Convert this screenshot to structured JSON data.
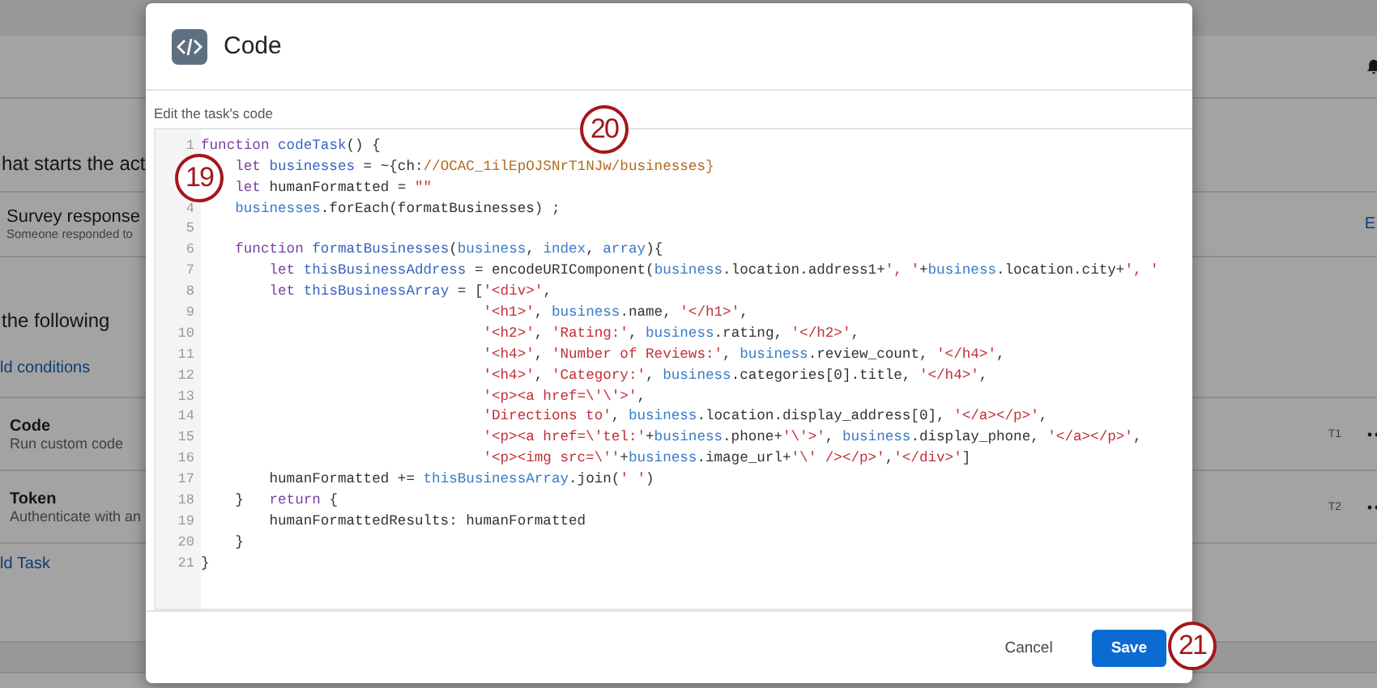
{
  "background": {
    "trigger_heading": "hat starts the act",
    "trigger": {
      "title": "Survey response",
      "subtitle": "Someone responded to",
      "action": "E"
    },
    "conditions_heading": "the following",
    "add_conditions": "ld conditions",
    "tasks": [
      {
        "title": "Code",
        "subtitle": "Run custom code",
        "tag": "T1"
      },
      {
        "title": "Token",
        "subtitle": "Authenticate with an",
        "tag": "T2"
      }
    ],
    "add_task": "ld Task"
  },
  "dialog": {
    "title": "Code",
    "editor_label": "Edit the task's code",
    "code_lines": [
      {
        "number": "1",
        "tokens": [
          {
            "kind": "keyword",
            "text": "function "
          },
          {
            "kind": "name",
            "text": "codeTask"
          },
          {
            "kind": "plain",
            "text": "() {"
          }
        ]
      },
      {
        "tokens": [
          {
            "kind": "keyword",
            "text": "    let "
          },
          {
            "kind": "name",
            "text": "businesses"
          },
          {
            "kind": "plain",
            "text": " = ~{ch:"
          },
          {
            "kind": "path",
            "text": "//OCAC_1ilEpOJSNrT1NJw/businesses}"
          }
        ]
      },
      {
        "tokens": [
          {
            "kind": "keyword",
            "text": "    let"
          },
          {
            "kind": "plain",
            "text": " humanFormatted = "
          },
          {
            "kind": "string",
            "text": "\"\""
          }
        ]
      },
      {
        "number": "4",
        "tokens": [
          {
            "kind": "variable",
            "text": "    businesses"
          },
          {
            "kind": "plain",
            "text": ".forEach(formatBusinesses) ;"
          }
        ]
      },
      {
        "number": "5"
      },
      {
        "number": "6",
        "tokens": [
          {
            "kind": "keyword",
            "text": "    function "
          },
          {
            "kind": "name",
            "text": "formatBusinesses"
          },
          {
            "kind": "plain",
            "text": "("
          },
          {
            "kind": "variable",
            "text": "business"
          },
          {
            "kind": "plain",
            "text": ", "
          },
          {
            "kind": "variable",
            "text": "index"
          },
          {
            "kind": "plain",
            "text": ", "
          },
          {
            "kind": "variable",
            "text": "array"
          },
          {
            "kind": "plain",
            "text": "){"
          }
        ]
      },
      {
        "number": "7",
        "tokens": [
          {
            "kind": "keyword",
            "text": "        let "
          },
          {
            "kind": "name",
            "text": "thisBusinessAddress"
          },
          {
            "kind": "plain",
            "text": " = encodeURIComponent("
          },
          {
            "kind": "variable",
            "text": "business"
          },
          {
            "kind": "plain",
            "text": ".location.address1+"
          },
          {
            "kind": "string",
            "text": "', '"
          },
          {
            "kind": "plain",
            "text": "+"
          },
          {
            "kind": "variable",
            "text": "business"
          },
          {
            "kind": "plain",
            "text": ".location.city+"
          },
          {
            "kind": "string",
            "text": "', '"
          }
        ]
      },
      {
        "number": "8",
        "tokens": [
          {
            "kind": "keyword",
            "text": "        let "
          },
          {
            "kind": "name",
            "text": "thisBusinessArray"
          },
          {
            "kind": "plain",
            "text": " = ["
          },
          {
            "kind": "string",
            "text": "'<div>'"
          },
          {
            "kind": "plain",
            "text": ","
          }
        ]
      },
      {
        "number": "9",
        "tokens": [
          {
            "kind": "string",
            "text": "                                 '<h1>'"
          },
          {
            "kind": "plain",
            "text": ", "
          },
          {
            "kind": "variable",
            "text": "business"
          },
          {
            "kind": "plain",
            "text": ".name, "
          },
          {
            "kind": "string",
            "text": "'</h1>'"
          },
          {
            "kind": "plain",
            "text": ","
          }
        ]
      },
      {
        "number": "10",
        "tokens": [
          {
            "kind": "string",
            "text": "                                 '<h2>'"
          },
          {
            "kind": "plain",
            "text": ", "
          },
          {
            "kind": "string",
            "text": "'Rating:'"
          },
          {
            "kind": "plain",
            "text": ", "
          },
          {
            "kind": "variable",
            "text": "business"
          },
          {
            "kind": "plain",
            "text": ".rating, "
          },
          {
            "kind": "string",
            "text": "'</h2>'"
          },
          {
            "kind": "plain",
            "text": ","
          }
        ]
      },
      {
        "number": "11",
        "tokens": [
          {
            "kind": "string",
            "text": "                                 '<h4>'"
          },
          {
            "kind": "plain",
            "text": ", "
          },
          {
            "kind": "string",
            "text": "'Number of Reviews:'"
          },
          {
            "kind": "plain",
            "text": ", "
          },
          {
            "kind": "variable",
            "text": "business"
          },
          {
            "kind": "plain",
            "text": ".review_count, "
          },
          {
            "kind": "string",
            "text": "'</h4>'"
          },
          {
            "kind": "plain",
            "text": ","
          }
        ]
      },
      {
        "number": "12",
        "tokens": [
          {
            "kind": "string",
            "text": "                                 '<h4>'"
          },
          {
            "kind": "plain",
            "text": ", "
          },
          {
            "kind": "string",
            "text": "'Category:'"
          },
          {
            "kind": "plain",
            "text": ", "
          },
          {
            "kind": "variable",
            "text": "business"
          },
          {
            "kind": "plain",
            "text": ".categories[0].title, "
          },
          {
            "kind": "string",
            "text": "'</h4>'"
          },
          {
            "kind": "plain",
            "text": ","
          }
        ]
      },
      {
        "number": "13",
        "tokens": [
          {
            "kind": "string",
            "text": "                                 '<p><a href=\\'\\'>'"
          },
          {
            "kind": "plain",
            "text": ","
          }
        ]
      },
      {
        "number": "14",
        "tokens": [
          {
            "kind": "string",
            "text": "                                 'Directions to'"
          },
          {
            "kind": "plain",
            "text": ", "
          },
          {
            "kind": "variable",
            "text": "business"
          },
          {
            "kind": "plain",
            "text": ".location.display_address[0], "
          },
          {
            "kind": "string",
            "text": "'</a></p>'"
          },
          {
            "kind": "plain",
            "text": ","
          }
        ]
      },
      {
        "number": "15",
        "tokens": [
          {
            "kind": "string",
            "text": "                                 '<p><a href=\\'tel:'"
          },
          {
            "kind": "plain",
            "text": "+"
          },
          {
            "kind": "variable",
            "text": "business"
          },
          {
            "kind": "plain",
            "text": ".phone+"
          },
          {
            "kind": "string",
            "text": "'\\'>'"
          },
          {
            "kind": "plain",
            "text": ", "
          },
          {
            "kind": "variable",
            "text": "business"
          },
          {
            "kind": "plain",
            "text": ".display_phone, "
          },
          {
            "kind": "string",
            "text": "'</a></p>'"
          },
          {
            "kind": "plain",
            "text": ","
          }
        ]
      },
      {
        "number": "16",
        "tokens": [
          {
            "kind": "string",
            "text": "                                 '<p><img src=\\''"
          },
          {
            "kind": "plain",
            "text": "+"
          },
          {
            "kind": "variable",
            "text": "business"
          },
          {
            "kind": "plain",
            "text": ".image_url+"
          },
          {
            "kind": "string",
            "text": "'\\' /></p>'"
          },
          {
            "kind": "plain",
            "text": ","
          },
          {
            "kind": "string",
            "text": "'</div>'"
          },
          {
            "kind": "plain",
            "text": "]"
          }
        ]
      },
      {
        "number": "17",
        "tokens": [
          {
            "kind": "plain",
            "text": "        humanFormatted += "
          },
          {
            "kind": "variable",
            "text": "thisBusinessArray"
          },
          {
            "kind": "plain",
            "text": ".join("
          },
          {
            "kind": "string",
            "text": "' '"
          },
          {
            "kind": "plain",
            "text": ")"
          }
        ]
      },
      {
        "number": "18",
        "tokens": [
          {
            "kind": "plain",
            "text": "    }   "
          },
          {
            "kind": "keyword",
            "text": "return"
          },
          {
            "kind": "plain",
            "text": " {"
          }
        ]
      },
      {
        "number": "19",
        "tokens": [
          {
            "kind": "plain",
            "text": "        humanFormattedResults: humanFormatted"
          }
        ]
      },
      {
        "number": "20",
        "tokens": [
          {
            "kind": "plain",
            "text": "    }"
          }
        ]
      },
      {
        "number": "21",
        "tokens": [
          {
            "kind": "plain",
            "text": "}"
          }
        ]
      }
    ],
    "buttons": [
      {
        "label": "Cancel",
        "kind": "secondary"
      },
      {
        "label": "Save",
        "kind": "primary"
      }
    ]
  },
  "callouts": [
    "19",
    "20",
    "21"
  ]
}
